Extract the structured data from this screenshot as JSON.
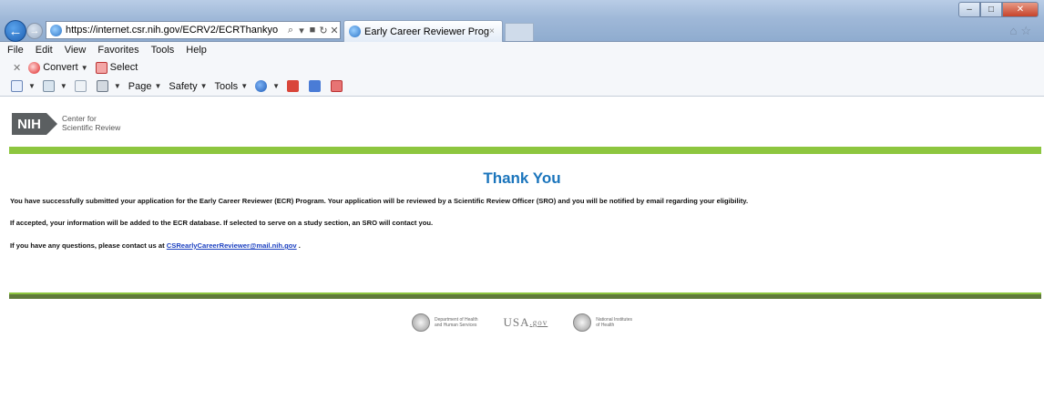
{
  "browser": {
    "url": "https://internet.csr.nih.gov/ECRV2/ECRThankyo",
    "tab_title": "Early Career Reviewer Progr...",
    "tab_close": "×",
    "menu": [
      "File",
      "Edit",
      "View",
      "Favorites",
      "Tools",
      "Help"
    ],
    "convert_label": "Convert",
    "select_label": "Select",
    "page_label": "Page",
    "safety_label": "Safety",
    "tools_label": "Tools"
  },
  "header": {
    "logo_text": "NIH",
    "org_line1": "Center for",
    "org_line2": "Scientific Review"
  },
  "main": {
    "heading": "Thank You",
    "message1": "You have successfully submitted your application for the Early Career Reviewer (ECR) Program. Your application will be reviewed by a Scientific Review Officer (SRO) and you will be notified by email regarding your eligibility.",
    "message2": "If accepted, your information will be added to the ECR database. If selected to serve on a study section, an SRO will contact you.",
    "message3_prefix": "If you have any questions, please contact us at ",
    "contact_email": "CSRearlyCareerReviewer@mail.nih.gov",
    "message3_suffix": " ."
  },
  "footer": {
    "hhs": "Department of Health\nand Human Services",
    "usa": "USA",
    "usa_gov": ".gov",
    "nih": "National Institutes\nof Health"
  }
}
